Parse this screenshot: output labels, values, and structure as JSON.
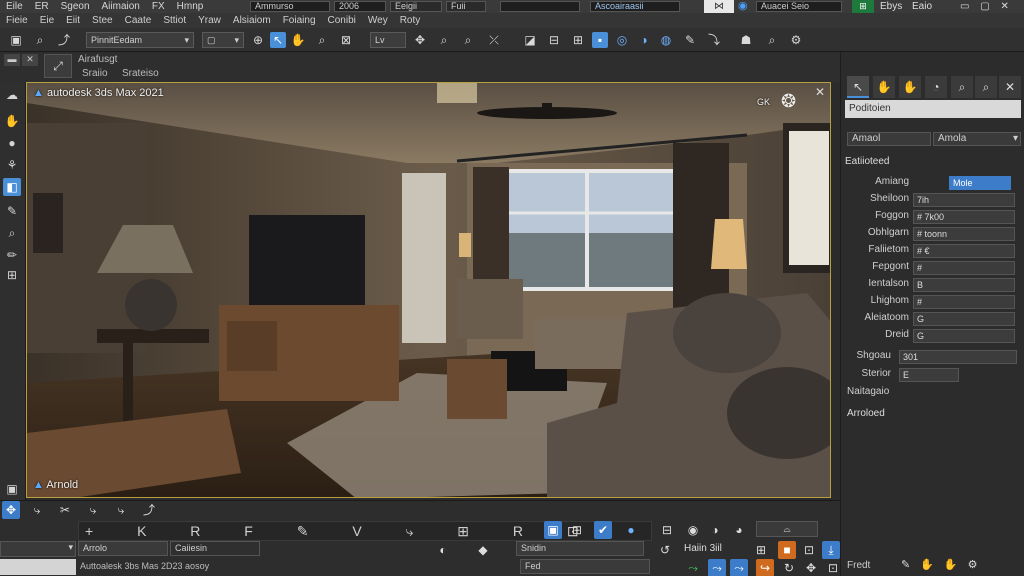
{
  "menubar": {
    "items": [
      "Eile",
      "ER",
      "Sgeon",
      "Aiimaion",
      "FX",
      "Hmnp"
    ],
    "field1": "Ammurso",
    "field2": "2006",
    "field3": "Eeigii",
    "field4": "Fuii",
    "field5": "Ascoairaasii",
    "field6": "Auacei Seio",
    "field7": "Ebys",
    "field8": "Eaio"
  },
  "menubar2": {
    "items": [
      "Fieie",
      "Eie",
      "Eiit",
      "Stee",
      "Caate",
      "Sttiot",
      "Yraw",
      "Alsiaiom",
      "Foiaing",
      "Conibi",
      "Wey",
      "Roty"
    ]
  },
  "toolbar": {
    "selection_set": "PinnitEedam",
    "view_set": "Lv",
    "view_dd": "▢"
  },
  "subbar": {
    "label1": "Airafusgt",
    "label2": "Sraiio",
    "label3": "Srateiso"
  },
  "viewport": {
    "title": "autodesk 3ds Max 2021",
    "renderer": "Arnold",
    "overlay": "GK"
  },
  "panel": {
    "search": "Poditoien",
    "drop1": "Amaol",
    "drop2": "Amola",
    "section": "Eatiioteed",
    "rows": [
      {
        "label": "Amiang",
        "value": "Mole"
      },
      {
        "label": "Sheiloon",
        "value": "7ih"
      },
      {
        "label": "Foggon",
        "value": "# 7k00"
      },
      {
        "label": "Obhlgarn",
        "value": "# toonn"
      },
      {
        "label": "Faliietom",
        "value": "# €"
      },
      {
        "label": "Fepgont",
        "value": "#"
      },
      {
        "label": "Ientalson",
        "value": "B"
      },
      {
        "label": "Lhighom",
        "value": "#"
      },
      {
        "label": "Aleiatoom",
        "value": "G"
      },
      {
        "label": "Dreid",
        "value": "G"
      }
    ],
    "extra_rows": [
      {
        "label": "Shgoau",
        "value": "301"
      },
      {
        "label": "Sterior",
        "value": "E"
      },
      {
        "label": "Naitagaio",
        "value": ""
      }
    ],
    "footer": "Arroloed",
    "bottom_label": "Fredt"
  },
  "bottom": {
    "field1": "Arrolo",
    "field2": "Caiiesin",
    "field3": "Snidin",
    "status": "Auttoalesk 3bs Mas 2D23 aosoy",
    "trans_label": "Haiin 3iil",
    "time_field": "Fed"
  },
  "colors": {
    "accent": "#4a90d9",
    "viewport_border": "#b8a040"
  }
}
